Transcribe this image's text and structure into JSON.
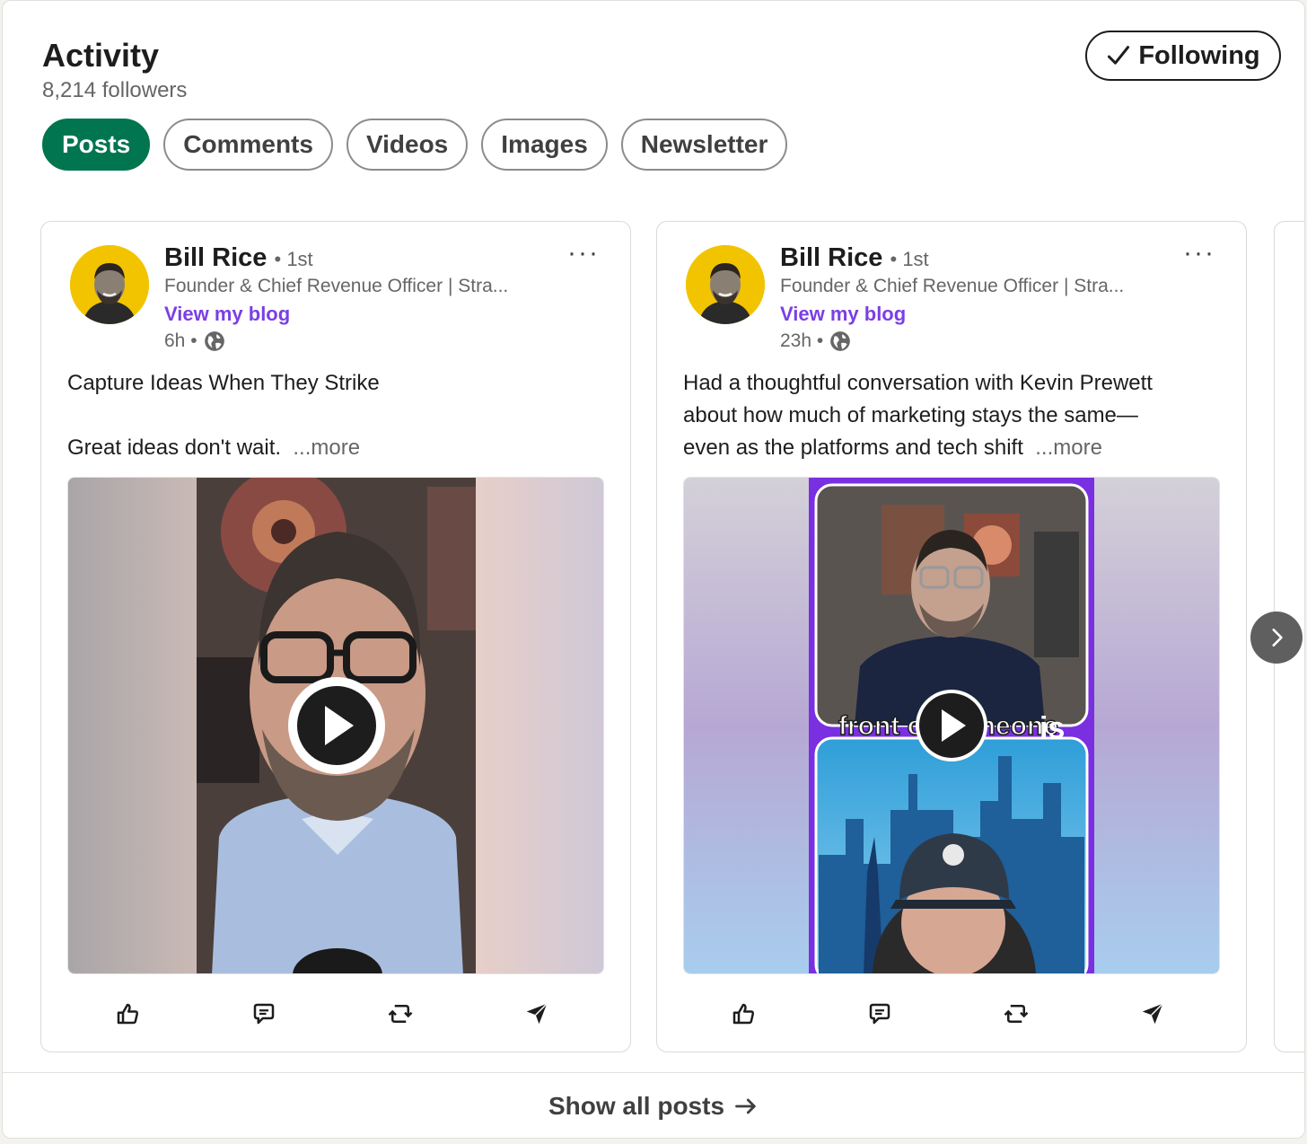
{
  "activity": {
    "title": "Activity",
    "followers": "8,214 followers",
    "follow_button": "Following"
  },
  "tabs": [
    {
      "label": "Posts",
      "active": true
    },
    {
      "label": "Comments",
      "active": false
    },
    {
      "label": "Videos",
      "active": false
    },
    {
      "label": "Images",
      "active": false
    },
    {
      "label": "Newsletter",
      "active": false
    }
  ],
  "posts": [
    {
      "author": "Bill Rice",
      "degree": "• 1st",
      "headline": "Founder & Chief Revenue Officer | Stra...",
      "link": "View my blog",
      "time": "6h •",
      "text_lines": [
        "Capture Ideas When They Strike",
        "",
        "Great ideas don't wait."
      ],
      "more": "...more"
    },
    {
      "author": "Bill Rice",
      "degree": "• 1st",
      "headline": "Founder & Chief Revenue Officer | Stra...",
      "link": "View my blog",
      "time": "23h •",
      "text_lines": [
        "Had a thoughtful conversation with Kevin Prewett",
        "about how much of marketing stays the same—",
        "even as the platforms and tech shift"
      ],
      "more": "...more",
      "video_caption_left": "front of someone",
      "video_caption_right": "is"
    }
  ],
  "footer": {
    "show_all": "Show all posts"
  },
  "colors": {
    "accent_green": "#01754f",
    "link_purple": "#7b3fe4",
    "video_frame_purple": "#7a2fe0"
  }
}
